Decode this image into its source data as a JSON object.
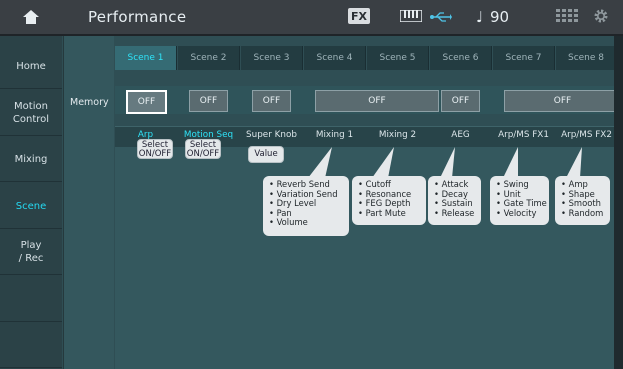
{
  "header": {
    "title": "Performance",
    "fx_badge": "FX",
    "tempo": "90",
    "icons": [
      "home-icon",
      "keyboard-icon",
      "usb-icon",
      "note-icon",
      "grid-icon",
      "gear-icon"
    ]
  },
  "nav": {
    "items": [
      {
        "label": "Home"
      },
      {
        "label": "Motion\nControl"
      },
      {
        "label": "Mixing"
      },
      {
        "label": "Scene"
      },
      {
        "label": "Play\n/ Rec"
      }
    ],
    "active": "Scene"
  },
  "subnav": {
    "memory": "Memory"
  },
  "tabs": [
    "Scene 1",
    "Scene 2",
    "Scene 3",
    "Scene 4",
    "Scene 5",
    "Scene 6",
    "Scene 7",
    "Scene 8"
  ],
  "off_buttons": [
    "OFF",
    "OFF",
    "OFF",
    "OFF",
    "OFF",
    "OFF"
  ],
  "params": [
    "Arp",
    "Motion Seq",
    "Super Knob",
    "Mixing 1",
    "Mixing 2",
    "AEG",
    "Arp/MS FX1",
    "Arp/MS FX2"
  ],
  "chips": {
    "arp": "Select\nON/OFF",
    "motion_seq": "Select\nON/OFF",
    "super_knob": "Value"
  },
  "callouts": {
    "mixing1": [
      "Reverb Send",
      "Variation Send",
      "Dry Level",
      "Pan",
      "Volume"
    ],
    "mixing2": [
      "Cutoff",
      "Resonance",
      "FEG Depth",
      "Part Mute"
    ],
    "aeg": [
      "Attack",
      "Decay",
      "Sustain",
      "Release"
    ],
    "fx1": [
      "Swing",
      "Unit",
      "Gate Time",
      "Velocity"
    ],
    "fx2": [
      "Amp",
      "Shape",
      "Smooth",
      "Random"
    ]
  },
  "colors": {
    "accent": "#2ee3f8",
    "panel": "#2f4e54"
  }
}
